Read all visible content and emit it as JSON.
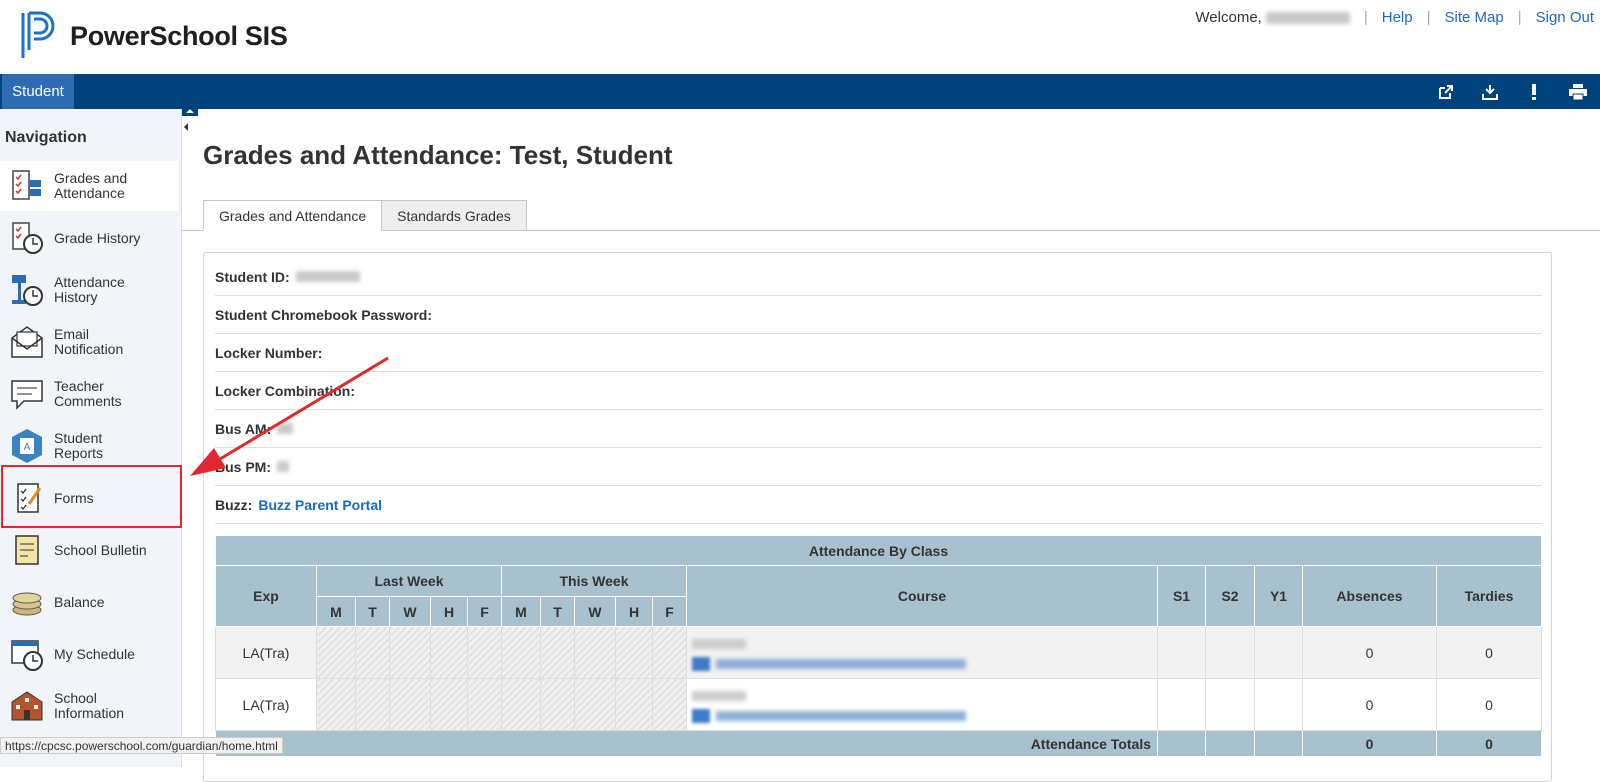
{
  "app": {
    "name": "PowerSchool SIS"
  },
  "header": {
    "welcome": "Welcome,",
    "links": [
      "Help",
      "Site Map",
      "Sign Out"
    ]
  },
  "bluebar": {
    "tab": "Student",
    "icons": [
      "external-link-icon",
      "download-icon",
      "alert-icon",
      "print-icon"
    ]
  },
  "sidebar": {
    "title": "Navigation",
    "items": [
      {
        "label": "Grades and Attendance",
        "icon": "grades-icon"
      },
      {
        "label": "Grade History",
        "icon": "grade-history-icon"
      },
      {
        "label": "Attendance History",
        "icon": "attendance-history-icon"
      },
      {
        "label": "Email Notification",
        "icon": "email-icon"
      },
      {
        "label": "Teacher Comments",
        "icon": "comments-icon"
      },
      {
        "label": "Student Reports",
        "icon": "reports-icon"
      },
      {
        "label": "Forms",
        "icon": "forms-icon"
      },
      {
        "label": "School Bulletin",
        "icon": "bulletin-icon"
      },
      {
        "label": "Balance",
        "icon": "balance-icon"
      },
      {
        "label": "My Schedule",
        "icon": "schedule-icon"
      },
      {
        "label": "School Information",
        "icon": "school-icon"
      }
    ]
  },
  "main": {
    "title": "Grades and Attendance: Test, Student",
    "tabs": [
      "Grades and Attendance",
      "Standards Grades"
    ],
    "info": {
      "student_id": "Student ID:",
      "chromebook": "Student Chromebook Password:",
      "locker_number": "Locker Number:",
      "locker_combination": "Locker Combination:",
      "bus_am": "Bus AM:",
      "bus_pm": "Bus PM:",
      "buzz": "Buzz:",
      "buzz_link": "Buzz Parent Portal"
    },
    "attendance": {
      "caption": "Attendance By Class",
      "headers": {
        "exp": "Exp",
        "last_week": "Last Week",
        "this_week": "This Week",
        "days": [
          "M",
          "T",
          "W",
          "H",
          "F"
        ],
        "course": "Course",
        "s1": "S1",
        "s2": "S2",
        "y1": "Y1",
        "absences": "Absences",
        "tardies": "Tardies"
      },
      "rows": [
        {
          "exp": "LA(Tra)",
          "absences": "0",
          "tardies": "0"
        },
        {
          "exp": "LA(Tra)",
          "absences": "0",
          "tardies": "0"
        }
      ],
      "totals": {
        "label": "Attendance Totals",
        "absences": "0",
        "tardies": "0"
      }
    }
  },
  "status_url": "https://cpcsc.powerschool.com/guardian/home.html",
  "colors": {
    "brand_bar": "#00427c",
    "student_tab": "#2d6cb3",
    "highlight": "#e0282e",
    "table_header": "#a7c1cf"
  }
}
